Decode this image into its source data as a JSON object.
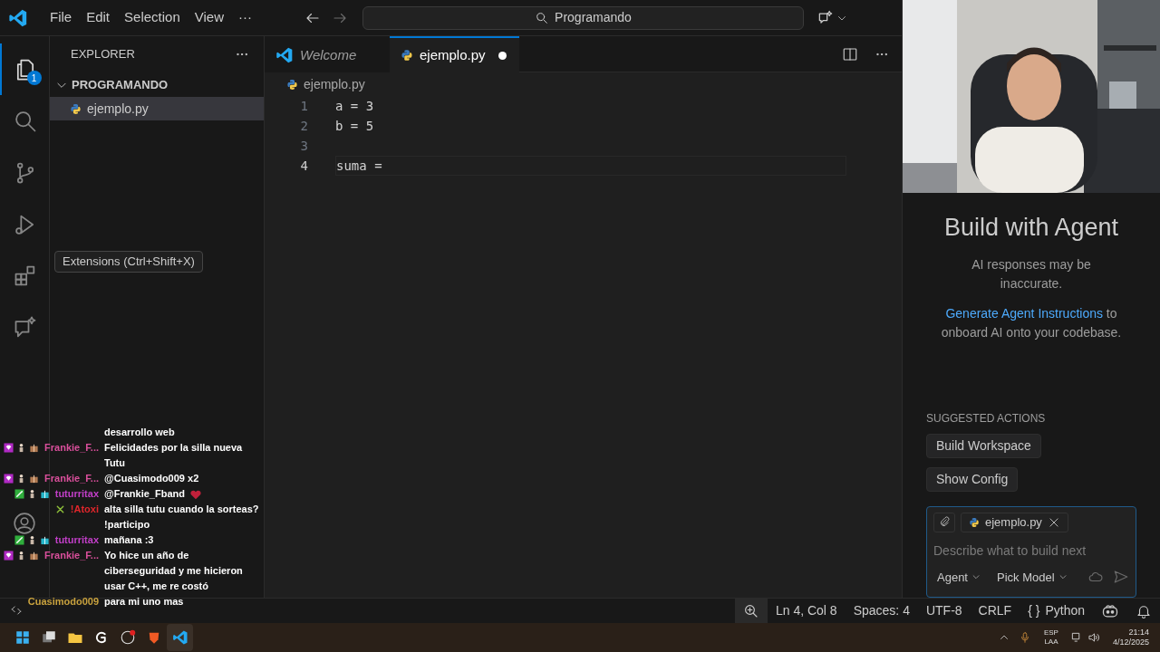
{
  "menu": [
    "File",
    "Edit",
    "Selection",
    "View",
    "···"
  ],
  "command_center": {
    "text": "Programando"
  },
  "activity_bar": [
    {
      "kind": "files",
      "selected": true,
      "badge": "1"
    },
    {
      "kind": "search",
      "selected": false
    },
    {
      "kind": "source_control",
      "selected": false
    },
    {
      "kind": "run",
      "selected": false
    },
    {
      "kind": "extensions",
      "selected": false
    },
    {
      "kind": "chat",
      "selected": false
    }
  ],
  "tooltip": "Extensions (Ctrl+Shift+X)",
  "sidebar": {
    "title": "EXPLORER",
    "folder": {
      "label": "PROGRAMANDO",
      "expanded": true,
      "children": [
        {
          "label": "ejemplo.py",
          "selected": true
        }
      ]
    }
  },
  "tabs": [
    {
      "label": "Welcome",
      "kind": "welcome",
      "selected": false,
      "dirty": false
    },
    {
      "label": "ejemplo.py",
      "kind": "python",
      "selected": true,
      "dirty": true
    }
  ],
  "breadcrumb": "ejemplo.py",
  "editor": {
    "lines": [
      {
        "number": "1",
        "code": "a = 3",
        "current": false
      },
      {
        "number": "2",
        "code": "b = 5",
        "current": false
      },
      {
        "number": "3",
        "current": false
      },
      {
        "number": "4",
        "code": "suma =",
        "current": true
      }
    ]
  },
  "agent_panel": {
    "title": "Build with Agent",
    "note": "AI responses may be inaccurate.",
    "link": "Generate Agent Instructions",
    "link_rest": "to onboard AI onto your codebase.",
    "suggested_title": "SUGGESTED ACTIONS",
    "actions": [
      "Build Workspace",
      "Show Config"
    ],
    "attachment": "ejemplo.py",
    "placeholder": "Describe what to build next",
    "mode": "Agent",
    "model": "Pick Model"
  },
  "chat": [
    {
      "text": "desarrollo web",
      "emote": false
    },
    {
      "badges": [
        {
          "kind": "gem"
        },
        {
          "kind": "figure"
        },
        {
          "kind": "present"
        }
      ],
      "user": "Frankie_F...",
      "color": "#d94f9b",
      "text": "Felicidades por la silla nueva Tutu",
      "emote": false
    },
    {
      "badges": [
        {
          "kind": "gem"
        },
        {
          "kind": "figure"
        },
        {
          "kind": "present"
        }
      ],
      "user": "Frankie_F...",
      "color": "#d94f9b",
      "text": "@Cuasimodo009 x2",
      "emote": false
    },
    {
      "badges": [
        {
          "kind": "sword"
        },
        {
          "kind": "figure"
        },
        {
          "kind": "present_teal"
        }
      ],
      "user": "tuturritax",
      "color": "#c23fc8",
      "text": "@Frankie_Fband",
      "emote": true
    },
    {
      "badges": [
        {
          "kind": "cross"
        }
      ],
      "user": "!Atoxi",
      "color": "#e0262b",
      "text": "alta silla tutu cuando la sorteas? !participo",
      "emote": false
    },
    {
      "badges": [
        {
          "kind": "sword"
        },
        {
          "kind": "figure"
        },
        {
          "kind": "present_teal"
        }
      ],
      "user": "tuturritax",
      "color": "#c23fc8",
      "text": "mañana :3",
      "emote": false
    },
    {
      "badges": [
        {
          "kind": "gem"
        },
        {
          "kind": "figure"
        },
        {
          "kind": "present"
        }
      ],
      "user": "Frankie_F...",
      "color": "#d94f9b",
      "text": "Yo hice un año de ciberseguridad y me hicieron usar C++, me re costó",
      "emote": false
    },
    {
      "user": "Cuasimodo009",
      "color": "#c9a23e",
      "text": "para mi uno mas",
      "emote": false
    }
  ],
  "status_bar": [
    {
      "kind": "zoom"
    },
    {
      "kind": "text",
      "text": "Ln 4, Col 8"
    },
    {
      "kind": "text",
      "text": "Spaces: 4"
    },
    {
      "kind": "text",
      "text": "UTF-8"
    },
    {
      "kind": "text",
      "text": "CRLF"
    },
    {
      "kind": "language",
      "icon": "{ }",
      "text": "Python"
    },
    {
      "kind": "copilot"
    },
    {
      "kind": "bell"
    }
  ],
  "taskbar": {
    "apps": [
      {
        "kind": "start",
        "selected": false
      },
      {
        "kind": "taskview",
        "selected": false
      },
      {
        "kind": "files",
        "selected": false
      },
      {
        "kind": "ghub",
        "selected": false
      },
      {
        "kind": "obs",
        "selected": false
      },
      {
        "kind": "brave",
        "selected": false
      },
      {
        "kind": "vscode",
        "selected": true
      }
    ],
    "lang": [
      "ESP",
      "LAA"
    ],
    "time": "21:14",
    "date": "4/12/2025"
  }
}
